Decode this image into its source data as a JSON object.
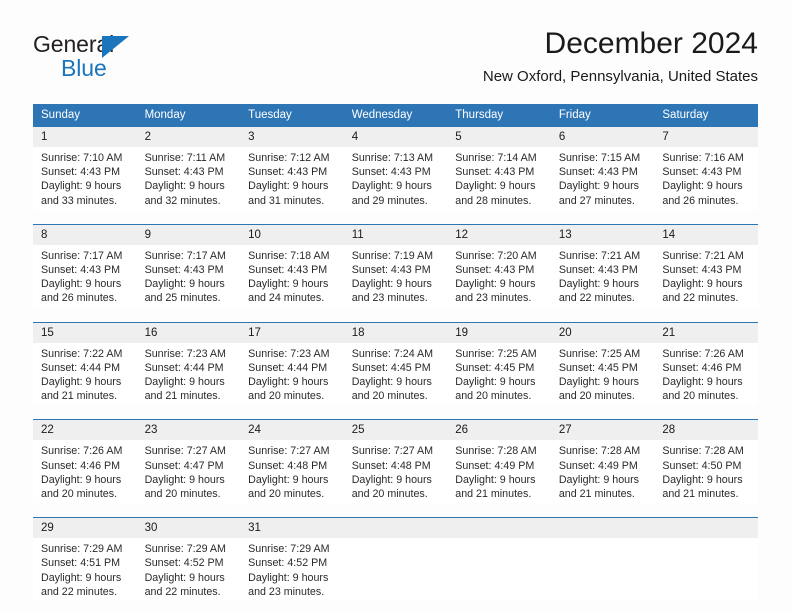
{
  "brand": {
    "name_line1": "General",
    "name_line2": "Blue",
    "triangle_icon": "triangle-logo-icon",
    "accent_color": "#1b75bc"
  },
  "header": {
    "title": "December 2024",
    "subtitle": "New Oxford, Pennsylvania, United States",
    "header_bg_color": "#2e75b6",
    "daynum_bg_color": "#efefef"
  },
  "weekdays": [
    "Sunday",
    "Monday",
    "Tuesday",
    "Wednesday",
    "Thursday",
    "Friday",
    "Saturday"
  ],
  "labels": {
    "sunrise_prefix": "Sunrise:",
    "sunset_prefix": "Sunset:",
    "daylight_prefix": "Daylight:"
  },
  "weeks": [
    [
      {
        "day": "1",
        "sunrise": "Sunrise: 7:10 AM",
        "sunset": "Sunset: 4:43 PM",
        "daylight_line1": "Daylight: 9 hours",
        "daylight_line2": "and 33 minutes."
      },
      {
        "day": "2",
        "sunrise": "Sunrise: 7:11 AM",
        "sunset": "Sunset: 4:43 PM",
        "daylight_line1": "Daylight: 9 hours",
        "daylight_line2": "and 32 minutes."
      },
      {
        "day": "3",
        "sunrise": "Sunrise: 7:12 AM",
        "sunset": "Sunset: 4:43 PM",
        "daylight_line1": "Daylight: 9 hours",
        "daylight_line2": "and 31 minutes."
      },
      {
        "day": "4",
        "sunrise": "Sunrise: 7:13 AM",
        "sunset": "Sunset: 4:43 PM",
        "daylight_line1": "Daylight: 9 hours",
        "daylight_line2": "and 29 minutes."
      },
      {
        "day": "5",
        "sunrise": "Sunrise: 7:14 AM",
        "sunset": "Sunset: 4:43 PM",
        "daylight_line1": "Daylight: 9 hours",
        "daylight_line2": "and 28 minutes."
      },
      {
        "day": "6",
        "sunrise": "Sunrise: 7:15 AM",
        "sunset": "Sunset: 4:43 PM",
        "daylight_line1": "Daylight: 9 hours",
        "daylight_line2": "and 27 minutes."
      },
      {
        "day": "7",
        "sunrise": "Sunrise: 7:16 AM",
        "sunset": "Sunset: 4:43 PM",
        "daylight_line1": "Daylight: 9 hours",
        "daylight_line2": "and 26 minutes."
      }
    ],
    [
      {
        "day": "8",
        "sunrise": "Sunrise: 7:17 AM",
        "sunset": "Sunset: 4:43 PM",
        "daylight_line1": "Daylight: 9 hours",
        "daylight_line2": "and 26 minutes."
      },
      {
        "day": "9",
        "sunrise": "Sunrise: 7:17 AM",
        "sunset": "Sunset: 4:43 PM",
        "daylight_line1": "Daylight: 9 hours",
        "daylight_line2": "and 25 minutes."
      },
      {
        "day": "10",
        "sunrise": "Sunrise: 7:18 AM",
        "sunset": "Sunset: 4:43 PM",
        "daylight_line1": "Daylight: 9 hours",
        "daylight_line2": "and 24 minutes."
      },
      {
        "day": "11",
        "sunrise": "Sunrise: 7:19 AM",
        "sunset": "Sunset: 4:43 PM",
        "daylight_line1": "Daylight: 9 hours",
        "daylight_line2": "and 23 minutes."
      },
      {
        "day": "12",
        "sunrise": "Sunrise: 7:20 AM",
        "sunset": "Sunset: 4:43 PM",
        "daylight_line1": "Daylight: 9 hours",
        "daylight_line2": "and 23 minutes."
      },
      {
        "day": "13",
        "sunrise": "Sunrise: 7:21 AM",
        "sunset": "Sunset: 4:43 PM",
        "daylight_line1": "Daylight: 9 hours",
        "daylight_line2": "and 22 minutes."
      },
      {
        "day": "14",
        "sunrise": "Sunrise: 7:21 AM",
        "sunset": "Sunset: 4:43 PM",
        "daylight_line1": "Daylight: 9 hours",
        "daylight_line2": "and 22 minutes."
      }
    ],
    [
      {
        "day": "15",
        "sunrise": "Sunrise: 7:22 AM",
        "sunset": "Sunset: 4:44 PM",
        "daylight_line1": "Daylight: 9 hours",
        "daylight_line2": "and 21 minutes."
      },
      {
        "day": "16",
        "sunrise": "Sunrise: 7:23 AM",
        "sunset": "Sunset: 4:44 PM",
        "daylight_line1": "Daylight: 9 hours",
        "daylight_line2": "and 21 minutes."
      },
      {
        "day": "17",
        "sunrise": "Sunrise: 7:23 AM",
        "sunset": "Sunset: 4:44 PM",
        "daylight_line1": "Daylight: 9 hours",
        "daylight_line2": "and 20 minutes."
      },
      {
        "day": "18",
        "sunrise": "Sunrise: 7:24 AM",
        "sunset": "Sunset: 4:45 PM",
        "daylight_line1": "Daylight: 9 hours",
        "daylight_line2": "and 20 minutes."
      },
      {
        "day": "19",
        "sunrise": "Sunrise: 7:25 AM",
        "sunset": "Sunset: 4:45 PM",
        "daylight_line1": "Daylight: 9 hours",
        "daylight_line2": "and 20 minutes."
      },
      {
        "day": "20",
        "sunrise": "Sunrise: 7:25 AM",
        "sunset": "Sunset: 4:45 PM",
        "daylight_line1": "Daylight: 9 hours",
        "daylight_line2": "and 20 minutes."
      },
      {
        "day": "21",
        "sunrise": "Sunrise: 7:26 AM",
        "sunset": "Sunset: 4:46 PM",
        "daylight_line1": "Daylight: 9 hours",
        "daylight_line2": "and 20 minutes."
      }
    ],
    [
      {
        "day": "22",
        "sunrise": "Sunrise: 7:26 AM",
        "sunset": "Sunset: 4:46 PM",
        "daylight_line1": "Daylight: 9 hours",
        "daylight_line2": "and 20 minutes."
      },
      {
        "day": "23",
        "sunrise": "Sunrise: 7:27 AM",
        "sunset": "Sunset: 4:47 PM",
        "daylight_line1": "Daylight: 9 hours",
        "daylight_line2": "and 20 minutes."
      },
      {
        "day": "24",
        "sunrise": "Sunrise: 7:27 AM",
        "sunset": "Sunset: 4:48 PM",
        "daylight_line1": "Daylight: 9 hours",
        "daylight_line2": "and 20 minutes."
      },
      {
        "day": "25",
        "sunrise": "Sunrise: 7:27 AM",
        "sunset": "Sunset: 4:48 PM",
        "daylight_line1": "Daylight: 9 hours",
        "daylight_line2": "and 20 minutes."
      },
      {
        "day": "26",
        "sunrise": "Sunrise: 7:28 AM",
        "sunset": "Sunset: 4:49 PM",
        "daylight_line1": "Daylight: 9 hours",
        "daylight_line2": "and 21 minutes."
      },
      {
        "day": "27",
        "sunrise": "Sunrise: 7:28 AM",
        "sunset": "Sunset: 4:49 PM",
        "daylight_line1": "Daylight: 9 hours",
        "daylight_line2": "and 21 minutes."
      },
      {
        "day": "28",
        "sunrise": "Sunrise: 7:28 AM",
        "sunset": "Sunset: 4:50 PM",
        "daylight_line1": "Daylight: 9 hours",
        "daylight_line2": "and 21 minutes."
      }
    ],
    [
      {
        "day": "29",
        "sunrise": "Sunrise: 7:29 AM",
        "sunset": "Sunset: 4:51 PM",
        "daylight_line1": "Daylight: 9 hours",
        "daylight_line2": "and 22 minutes."
      },
      {
        "day": "30",
        "sunrise": "Sunrise: 7:29 AM",
        "sunset": "Sunset: 4:52 PM",
        "daylight_line1": "Daylight: 9 hours",
        "daylight_line2": "and 22 minutes."
      },
      {
        "day": "31",
        "sunrise": "Sunrise: 7:29 AM",
        "sunset": "Sunset: 4:52 PM",
        "daylight_line1": "Daylight: 9 hours",
        "daylight_line2": "and 23 minutes."
      },
      {
        "day": "",
        "sunrise": "",
        "sunset": "",
        "daylight_line1": "",
        "daylight_line2": ""
      },
      {
        "day": "",
        "sunrise": "",
        "sunset": "",
        "daylight_line1": "",
        "daylight_line2": ""
      },
      {
        "day": "",
        "sunrise": "",
        "sunset": "",
        "daylight_line1": "",
        "daylight_line2": ""
      },
      {
        "day": "",
        "sunrise": "",
        "sunset": "",
        "daylight_line1": "",
        "daylight_line2": ""
      }
    ]
  ]
}
